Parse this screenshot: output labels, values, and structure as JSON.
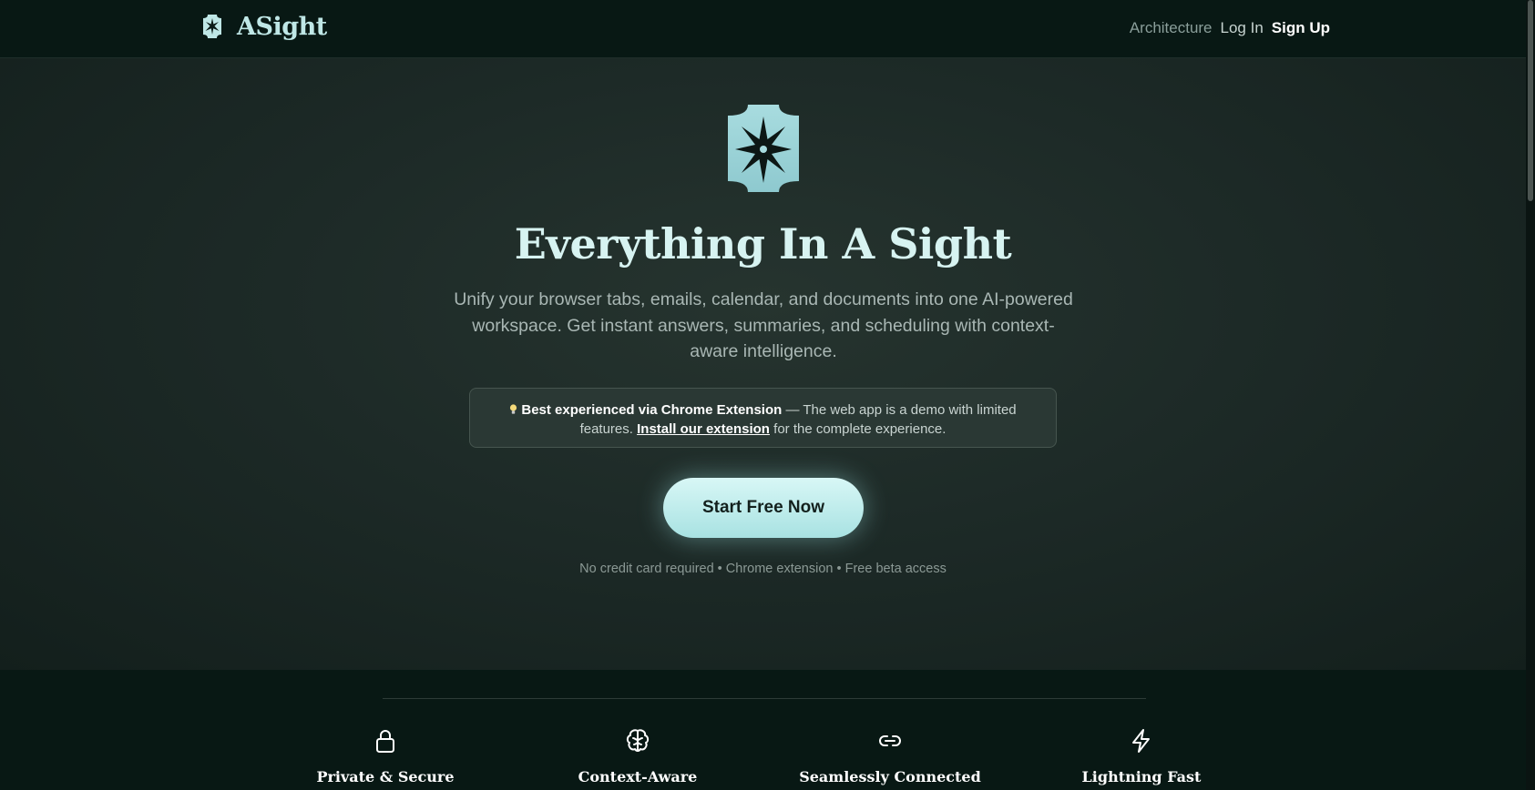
{
  "header": {
    "brand": "ASight",
    "logo_icon": "starburst-emblem-icon",
    "nav": {
      "architecture": "Architecture",
      "login": "Log In",
      "signup": "Sign Up"
    }
  },
  "hero": {
    "title": "Everything In A Sight",
    "subtitle": "Unify your browser tabs, emails, calendar, and documents into one AI-powered workspace. Get instant answers, summaries, and scheduling with context-aware intelligence.",
    "notice": {
      "icon": "lightbulb-icon",
      "bold": "Best experienced via Chrome Extension",
      "text_1": " — The web app is a demo with limited features. ",
      "link": "Install our extension",
      "text_2": " for the complete experience."
    },
    "cta": "Start Free Now",
    "fineprint": "No credit card required • Chrome extension • Free beta access"
  },
  "features": [
    {
      "icon": "lock-icon",
      "title": "Private & Secure"
    },
    {
      "icon": "brain-icon",
      "title": "Context-Aware"
    },
    {
      "icon": "link-icon",
      "title": "Seamlessly Connected"
    },
    {
      "icon": "lightning-icon",
      "title": "Lightning Fast"
    }
  ],
  "colors": {
    "background": "#0b1a17",
    "accent": "#bfe7e6",
    "cta_start": "#d8f7f6",
    "cta_end": "#a8e2e2"
  }
}
